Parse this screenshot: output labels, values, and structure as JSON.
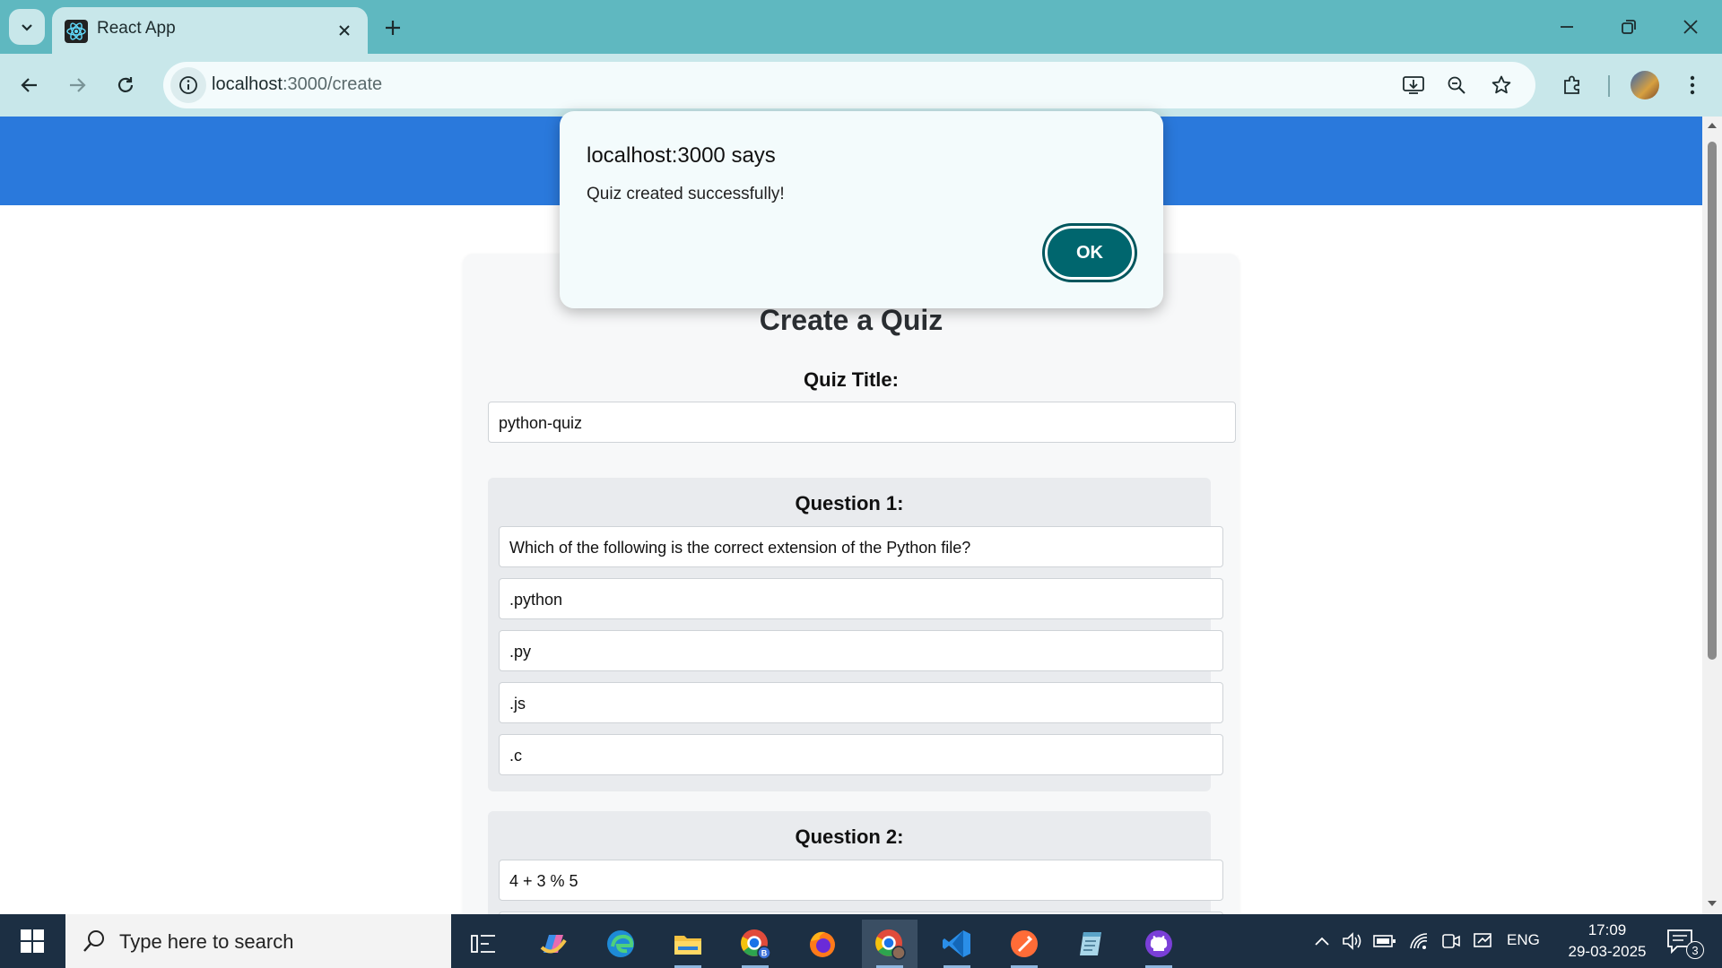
{
  "browser": {
    "tab_title": "React App",
    "url_host": "localhost",
    "url_path": ":3000/create"
  },
  "page": {
    "heading": "Create a Quiz",
    "quiz_title_label": "Quiz Title:",
    "quiz_title_value": "python-quiz",
    "questions": [
      {
        "label": "Question 1:",
        "text": "Which of the following is the correct extension of the Python file?",
        "options": [
          ".python",
          ".py",
          ".js",
          ".c"
        ]
      },
      {
        "label": "Question 2:",
        "text": "4 + 3 % 5",
        "options": []
      }
    ]
  },
  "dialog": {
    "title": "localhost:3000 says",
    "message": "Quiz created successfully!",
    "ok_label": "OK"
  },
  "taskbar": {
    "search_placeholder": "Type here to search",
    "language": "ENG",
    "time": "17:09",
    "date": "29-03-2025",
    "notification_count": "3"
  },
  "colors": {
    "tabbar": "#5fb8c0",
    "toolbar": "#c8e7ea",
    "app_header": "#2a79dc",
    "ok_button": "#00666e",
    "taskbar": "#1c2f43"
  },
  "icons": [
    "tab-search-icon",
    "react-icon",
    "close-icon",
    "plus-icon",
    "minimize-icon",
    "restore-icon",
    "back-arrow-icon",
    "forward-arrow-icon",
    "reload-icon",
    "info-icon",
    "install-app-icon",
    "zoom-icon",
    "star-icon",
    "extensions-icon",
    "menu-dots-icon",
    "windows-logo-icon",
    "search-icon",
    "task-view-icon",
    "copilot-icon",
    "edge-icon",
    "file-explorer-icon",
    "chrome-profile-icon",
    "firefox-icon",
    "chrome-icon",
    "vscode-icon",
    "postman-icon",
    "notepad-icon",
    "github-icon",
    "chevron-up-icon",
    "volume-icon",
    "battery-icon",
    "wifi-icon",
    "notification-icon"
  ]
}
